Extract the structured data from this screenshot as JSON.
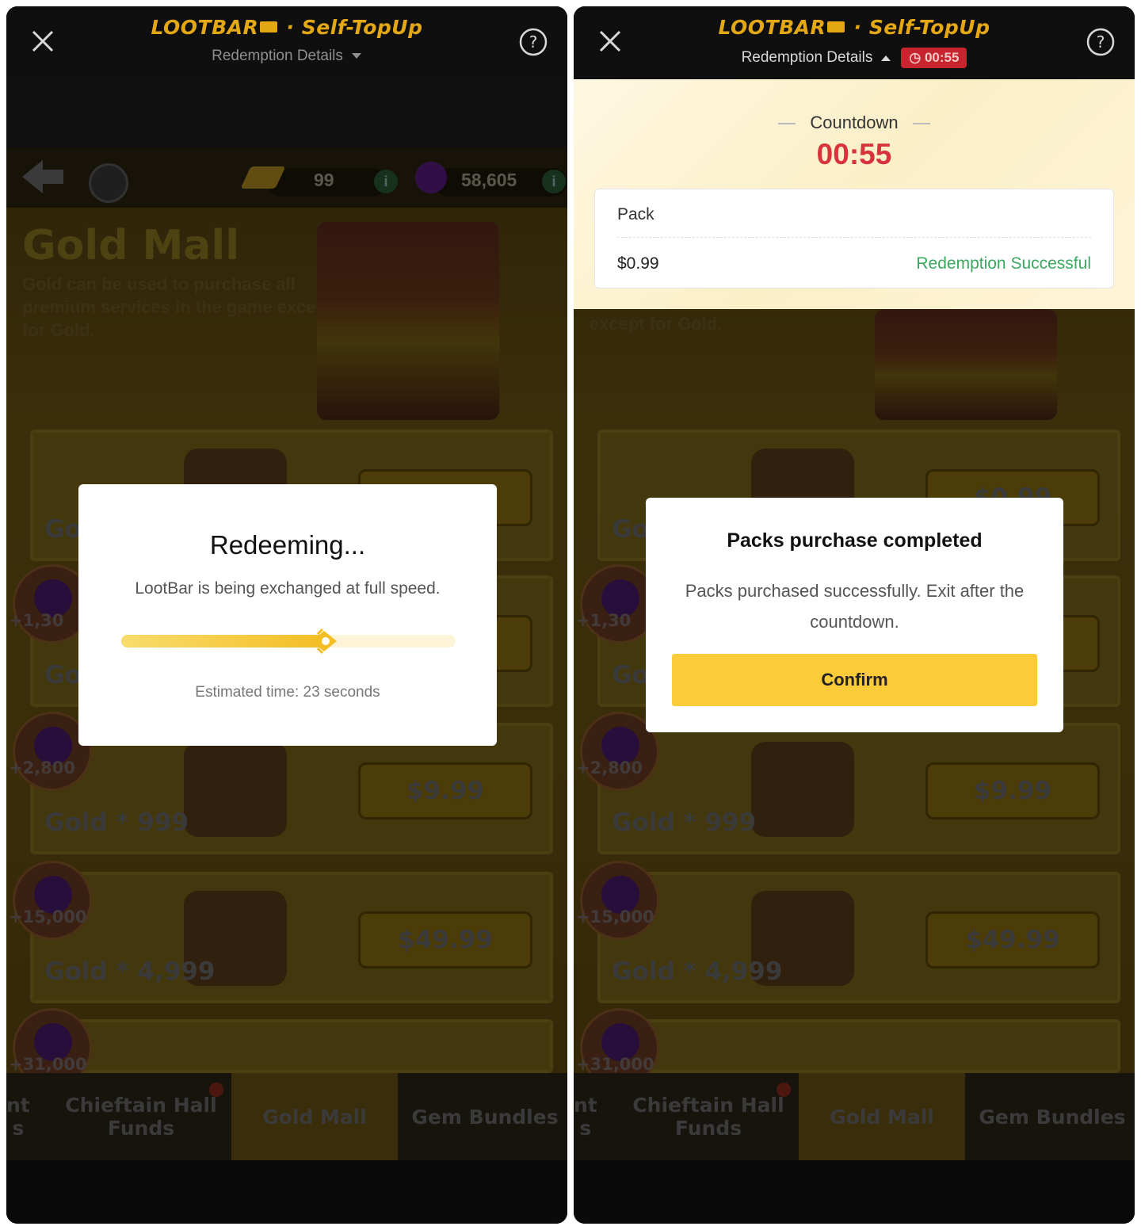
{
  "colors": {
    "accent_gold": "#e4a814",
    "timer_red": "#d8323a",
    "success_green": "#3aa860",
    "confirm_yellow": "#fccb3a"
  },
  "header": {
    "brand": "LOOTBAR",
    "brand_suffix": "· Self-TopUp",
    "redemption_details": "Redemption Details",
    "timer": "00:55"
  },
  "game": {
    "gold_amount": "99",
    "gem_amount": "58,605",
    "mall_title": "Gold Mall",
    "mall_desc": "Gold can be used to purchase all premium services in the game except for Gold.",
    "mall_desc_tail": "except for Gold.",
    "rows": [
      {
        "label": "Go",
        "price": "$0.99",
        "gem_bonus": ""
      },
      {
        "label": "Go",
        "price": "",
        "gem_bonus": "+1,30"
      },
      {
        "label": "Gold * 999",
        "price": "$9.99",
        "gem_bonus": "+2,800"
      },
      {
        "label": "Gold * 4,999",
        "price": "$49.99",
        "gem_bonus": "+15,000"
      },
      {
        "label": "",
        "price": "",
        "gem_bonus": "+31,000"
      }
    ],
    "tabs": {
      "partial": "nt\ns",
      "chieftain": "Chieftain Hall\nFunds",
      "gold_mall": "Gold Mall",
      "gem_bundles": "Gem Bundles"
    }
  },
  "left_modal": {
    "title": "Redeeming...",
    "subtitle": "LootBar is being exchanged at full speed.",
    "progress": 0.62,
    "estimate": "Estimated time: 23 seconds"
  },
  "countdown_sheet": {
    "label": "Countdown",
    "value": "00:55",
    "pack_name": "Pack",
    "pack_price": "$0.99",
    "status": "Redemption Successful"
  },
  "right_modal": {
    "title": "Packs purchase completed",
    "message": "Packs purchased successfully. Exit after the countdown.",
    "confirm": "Confirm"
  }
}
